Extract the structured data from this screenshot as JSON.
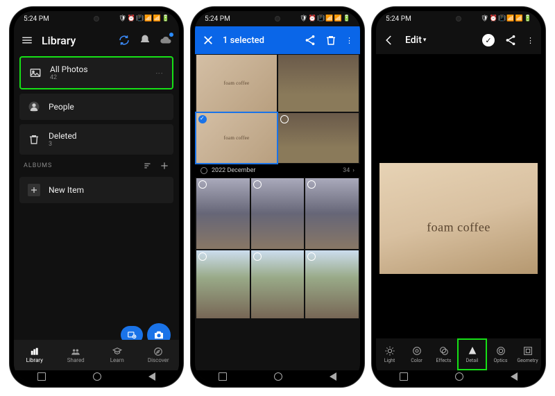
{
  "status": {
    "time": "5:24 PM",
    "icons": "🛡 ⏰ 📳 📶 📶 🔋"
  },
  "s1": {
    "title": "Library",
    "all_photos": {
      "label": "All Photos",
      "count": "42"
    },
    "people": {
      "label": "People"
    },
    "deleted": {
      "label": "Deleted",
      "count": "3"
    },
    "albums_header": "ALBUMS",
    "new_item": "New Item",
    "tabs": {
      "library": "Library",
      "shared": "Shared",
      "learn": "Learn",
      "discover": "Discover"
    }
  },
  "s2": {
    "title": "1 selected",
    "date_header": "2022 December",
    "count": "34"
  },
  "s3": {
    "title": "Edit",
    "photo_text": "foam coffee",
    "tools": {
      "light": "Light",
      "color": "Color",
      "effects": "Effects",
      "detail": "Detail",
      "optics": "Optics",
      "geometry": "Geometry"
    }
  }
}
